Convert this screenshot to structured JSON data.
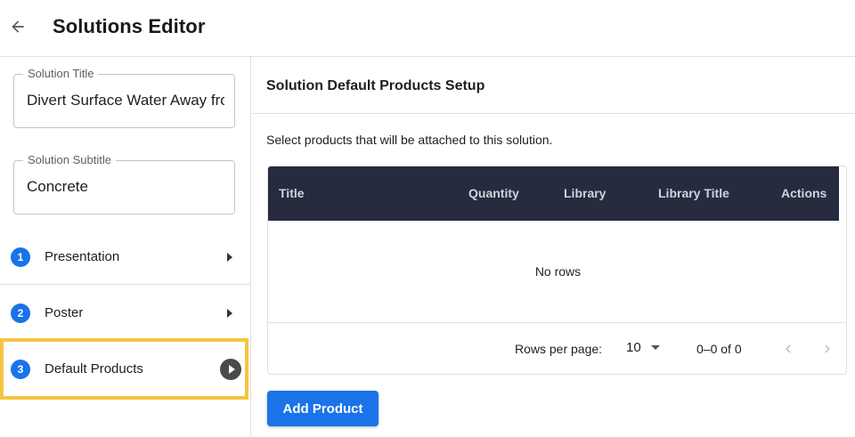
{
  "header": {
    "title": "Solutions Editor",
    "back_icon": "arrow-left-icon"
  },
  "sidebar": {
    "solution_title": {
      "label": "Solution Title",
      "value": "Divert Surface Water Away from"
    },
    "solution_subtitle": {
      "label": "Solution Subtitle",
      "value": "Concrete"
    },
    "steps": [
      {
        "number": "1",
        "label": "Presentation"
      },
      {
        "number": "2",
        "label": "Poster"
      },
      {
        "number": "3",
        "label": "Default Products"
      }
    ]
  },
  "main": {
    "title": "Solution Default Products Setup",
    "description": "Select products that will be attached to this solution.",
    "table": {
      "columns": [
        "Title",
        "Quantity",
        "Library",
        "Library Title",
        "Actions"
      ],
      "empty_text": "No rows",
      "rows_per_page_label": "Rows per page:",
      "rows_per_page_value": "10",
      "range_text": "0–0 of 0"
    },
    "add_button": "Add Product"
  },
  "colors": {
    "accent": "#1a73e8",
    "table_header": "#262b3f",
    "highlight": "#f5c542"
  }
}
